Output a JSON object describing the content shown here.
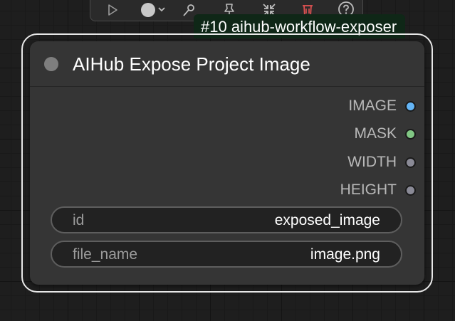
{
  "toolbar": {
    "buttons": [
      {
        "icon": "play-icon"
      },
      {
        "icon": "color-picker-icon"
      },
      {
        "icon": "bypass-icon"
      },
      {
        "icon": "pin-icon"
      },
      {
        "icon": "collapse-icon"
      },
      {
        "icon": "trash-icon"
      },
      {
        "icon": "help-icon"
      }
    ]
  },
  "badge": {
    "text": "#10 aihub-workflow-exposer"
  },
  "node": {
    "title": "AIHub Expose Project Image",
    "outputs": [
      {
        "label": "IMAGE",
        "color": "#64b5f6"
      },
      {
        "label": "MASK",
        "color": "#81c784"
      },
      {
        "label": "WIDTH",
        "color": "#8a8a96"
      },
      {
        "label": "HEIGHT",
        "color": "#8a8a96"
      }
    ],
    "widgets": [
      {
        "label": "id",
        "value": "exposed_image"
      },
      {
        "label": "file_name",
        "value": "image.png"
      }
    ]
  },
  "colors": {
    "canvas_bg": "#1e1e1e",
    "node_bg": "#353535",
    "badge_bg": "#0f2717",
    "trash": "#e05252"
  }
}
